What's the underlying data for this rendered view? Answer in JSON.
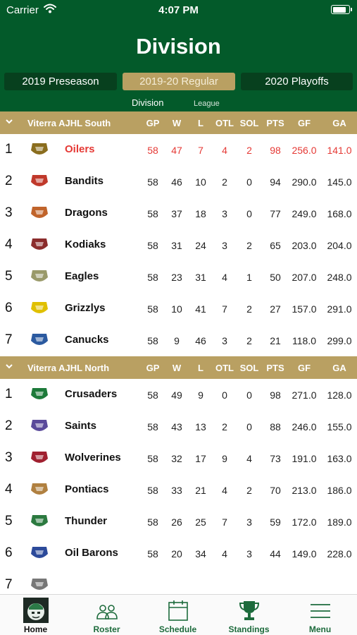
{
  "status_bar": {
    "carrier": "Carrier",
    "time": "4:07 PM",
    "battery_level": 0.9
  },
  "header": {
    "title": "Division"
  },
  "season_tabs": [
    {
      "label": "2019 Preseason",
      "active": false
    },
    {
      "label": "2019-20 Regular",
      "active": true
    },
    {
      "label": "2020 Playoffs",
      "active": false
    }
  ],
  "view_tabs": {
    "active": "Division",
    "inactive": "League"
  },
  "columns": [
    "GP",
    "W",
    "L",
    "OTL",
    "SOL",
    "PTS",
    "GF",
    "GA"
  ],
  "sections": [
    {
      "name": "Viterra AJHL South",
      "teams": [
        {
          "rank": "1",
          "name": "Oilers",
          "stats": [
            "58",
            "47",
            "7",
            "4",
            "2",
            "98",
            "256.0",
            "141.0"
          ],
          "highlight": true
        },
        {
          "rank": "2",
          "name": "Bandits",
          "stats": [
            "58",
            "46",
            "10",
            "2",
            "0",
            "94",
            "290.0",
            "145.0"
          ]
        },
        {
          "rank": "3",
          "name": "Dragons",
          "stats": [
            "58",
            "37",
            "18",
            "3",
            "0",
            "77",
            "249.0",
            "168.0"
          ]
        },
        {
          "rank": "4",
          "name": "Kodiaks",
          "stats": [
            "58",
            "31",
            "24",
            "3",
            "2",
            "65",
            "203.0",
            "204.0"
          ]
        },
        {
          "rank": "5",
          "name": "Eagles",
          "stats": [
            "58",
            "23",
            "31",
            "4",
            "1",
            "50",
            "207.0",
            "248.0"
          ]
        },
        {
          "rank": "6",
          "name": "Grizzlys",
          "stats": [
            "58",
            "10",
            "41",
            "7",
            "2",
            "27",
            "157.0",
            "291.0"
          ]
        },
        {
          "rank": "7",
          "name": "Canucks",
          "stats": [
            "58",
            "9",
            "46",
            "3",
            "2",
            "21",
            "118.0",
            "299.0"
          ]
        }
      ]
    },
    {
      "name": "Viterra AJHL North",
      "teams": [
        {
          "rank": "1",
          "name": "Crusaders",
          "stats": [
            "58",
            "49",
            "9",
            "0",
            "0",
            "98",
            "271.0",
            "128.0"
          ]
        },
        {
          "rank": "2",
          "name": "Saints",
          "stats": [
            "58",
            "43",
            "13",
            "2",
            "0",
            "88",
            "246.0",
            "155.0"
          ]
        },
        {
          "rank": "3",
          "name": "Wolverines",
          "stats": [
            "58",
            "32",
            "17",
            "9",
            "4",
            "73",
            "191.0",
            "163.0"
          ]
        },
        {
          "rank": "4",
          "name": "Pontiacs",
          "stats": [
            "58",
            "33",
            "21",
            "4",
            "2",
            "70",
            "213.0",
            "186.0"
          ]
        },
        {
          "rank": "5",
          "name": "Thunder",
          "stats": [
            "58",
            "26",
            "25",
            "7",
            "3",
            "59",
            "172.0",
            "189.0"
          ]
        },
        {
          "rank": "6",
          "name": "Oil Barons",
          "stats": [
            "58",
            "20",
            "34",
            "4",
            "3",
            "44",
            "149.0",
            "228.0"
          ]
        },
        {
          "rank": "7",
          "name": "",
          "stats": [
            "",
            "",
            "",
            "",
            "",
            "",
            "",
            ""
          ]
        }
      ]
    }
  ],
  "tab_bar": [
    {
      "label": "Home",
      "icon": "team-logo-icon"
    },
    {
      "label": "Roster",
      "icon": "people-icon"
    },
    {
      "label": "Schedule",
      "icon": "calendar-icon"
    },
    {
      "label": "Standings",
      "icon": "trophy-icon"
    },
    {
      "label": "Menu",
      "icon": "hamburger-icon"
    }
  ],
  "colors": {
    "header_green": "#035a2a",
    "gold": "#b9a062",
    "highlight_red": "#e53935",
    "tab_green": "#1d6b3c"
  }
}
